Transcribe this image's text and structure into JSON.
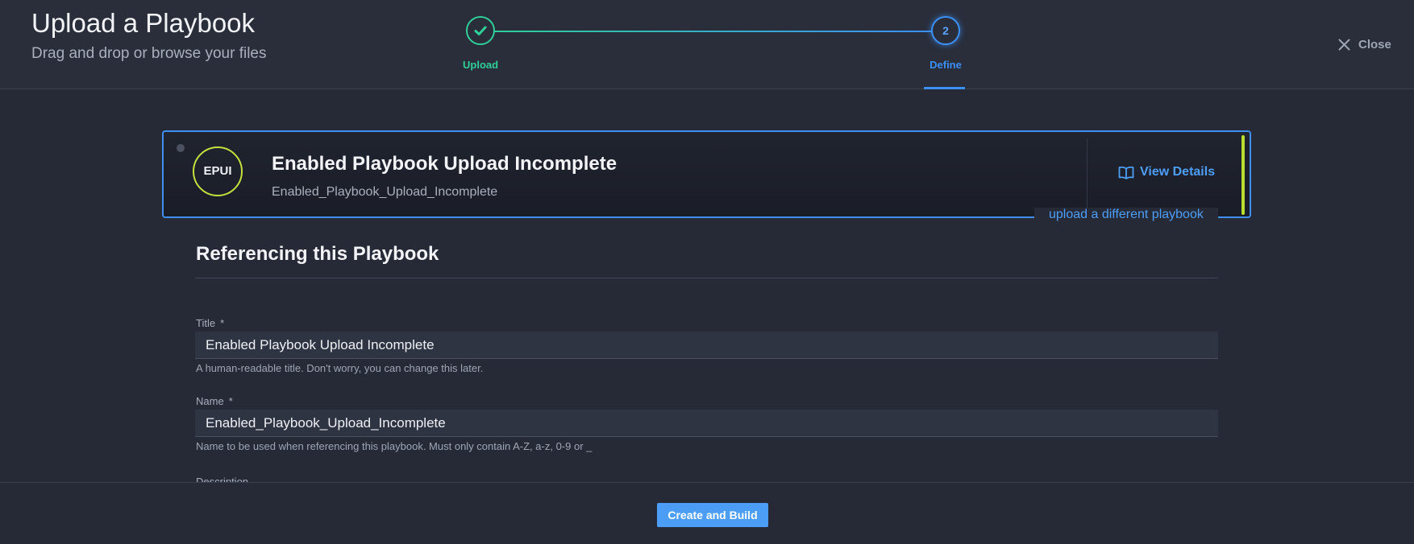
{
  "header": {
    "title": "Upload a Playbook",
    "subtitle": "Drag and drop or browse your files",
    "close_label": "Close",
    "steps": [
      {
        "label": "Upload",
        "state": "completed",
        "icon": "check-icon"
      },
      {
        "label": "Define",
        "number": "2",
        "state": "active"
      }
    ]
  },
  "playbook_card": {
    "avatar_initials": "EPUI",
    "title": "Enabled Playbook Upload Incomplete",
    "name": "Enabled_Playbook_Upload_Incomplete",
    "view_details_label": "View Details",
    "view_details_icon": "book-icon",
    "upload_different_label": "upload a different playbook"
  },
  "form": {
    "section_title": "Referencing this Playbook",
    "title_field": {
      "label": "Title",
      "required_marker": "*",
      "value": "Enabled Playbook Upload Incomplete",
      "hint": "A human-readable title. Don't worry, you can change this later."
    },
    "name_field": {
      "label": "Name",
      "required_marker": "*",
      "value": "Enabled_Playbook_Upload_Incomplete",
      "hint": "Name to be used when referencing this playbook. Must only contain A-Z, a-z, 0-9 or _"
    },
    "description_field": {
      "label": "Description"
    }
  },
  "footer": {
    "create_label": "Create and Build"
  },
  "colors": {
    "background": "#262a37",
    "accent_blue": "#3b8ff5",
    "accent_green": "#2fcf9a",
    "avatar_ring": "#c4e03c"
  }
}
